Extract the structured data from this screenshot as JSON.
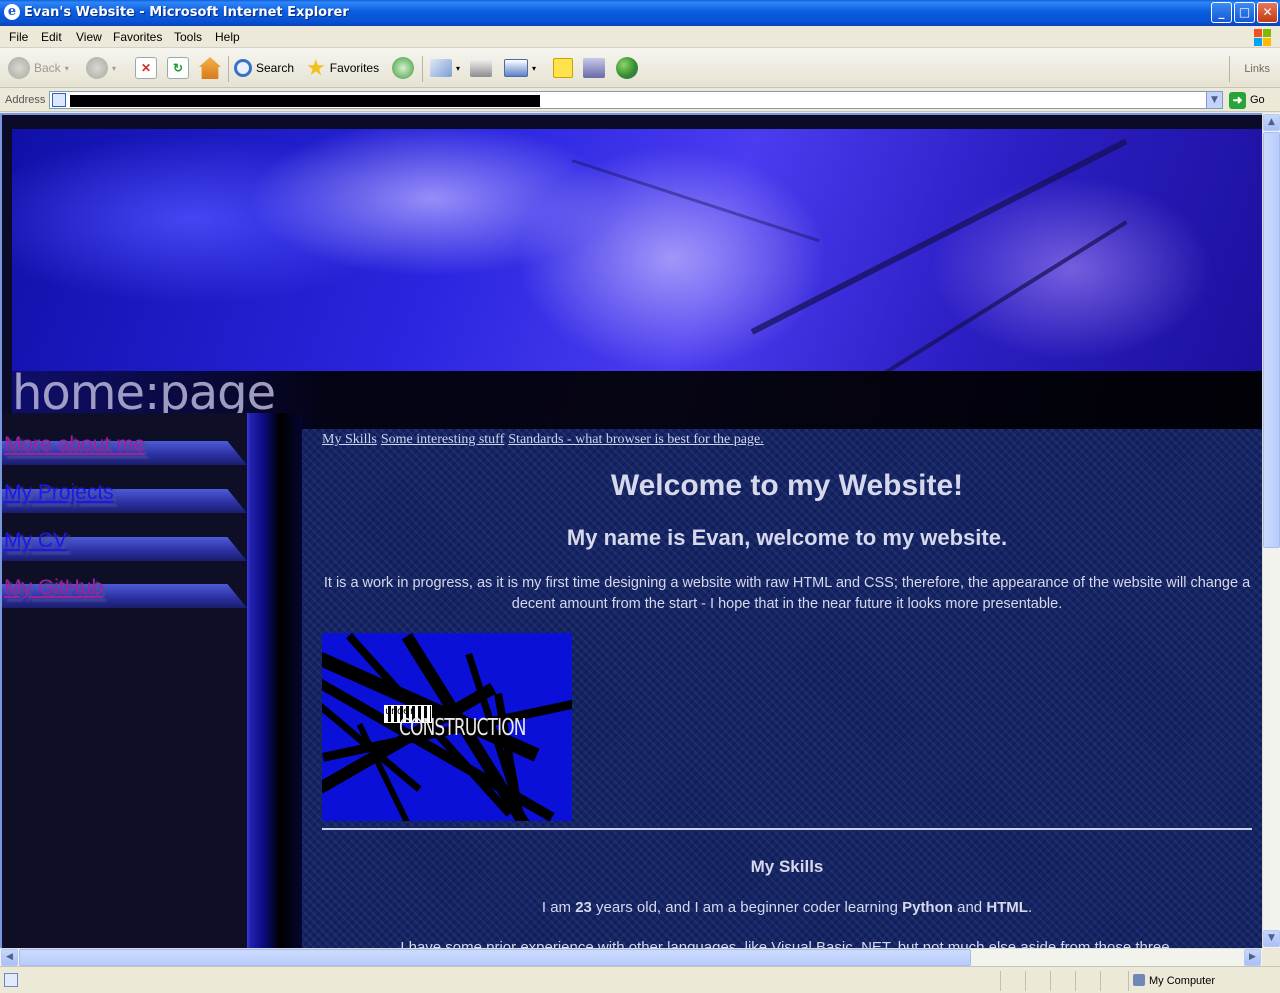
{
  "window": {
    "title": "Evan's Website - Microsoft Internet Explorer",
    "minimize": "_",
    "maximize": "□",
    "close": "✕"
  },
  "menu": [
    "File",
    "Edit",
    "View",
    "Favorites",
    "Tools",
    "Help"
  ],
  "toolbar": {
    "back": "Back",
    "search": "Search",
    "favorites": "Favorites",
    "links": "Links"
  },
  "address": {
    "label": "Address",
    "go": "Go"
  },
  "banner": {
    "text": "home:page"
  },
  "sidebar": {
    "items": [
      {
        "label": "More about me",
        "color": "#a020a0"
      },
      {
        "label": "My Projects",
        "color": "#1a1ae6"
      },
      {
        "label": "My CV",
        "color": "#1a1ae6"
      },
      {
        "label": "My GitHub",
        "color": "#a020a0"
      }
    ]
  },
  "topnav": [
    "My Skills",
    "Some interesting stuff",
    "Standards - what browser is best for the page."
  ],
  "main": {
    "heading": "Welcome to my Website!",
    "subheading": "My name is Evan, welcome to my website.",
    "intro": "It is a work in progress, as it is my first time designing a website with raw HTML and CSS; therefore, the appearance of the website will change a decent amount from the start - I hope that in the near future it looks more presentable.",
    "construction_under": "under",
    "construction_word": "CONSTRUCTION",
    "skills_title": "My Skills",
    "skills_p1_a": "I am ",
    "skills_age": "23",
    "skills_p1_b": " years old, and I am a beginner coder learning ",
    "skills_lang1": "Python",
    "skills_p1_c": " and ",
    "skills_lang2": "HTML",
    "skills_p1_d": ".",
    "skills_p2": "I have some prior experience with other languages, like Visual Basic .NET, but not much else aside from those three."
  },
  "status": {
    "zone": "My Computer"
  },
  "colors": {
    "titlebar": "#0b5ee0",
    "content_bg": "#142466",
    "banner_blue": "#2a26e0",
    "visited_link": "#a020a0",
    "link": "#1a1ae6"
  }
}
